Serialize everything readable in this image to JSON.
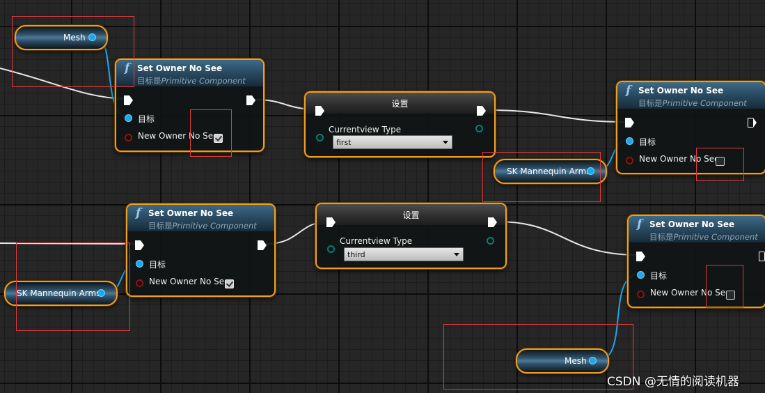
{
  "func_icon": "f",
  "function_nodes": [
    {
      "title": "Set Owner No See",
      "subtitle_prefix": "目标是",
      "subtitle_class": "Primitive Component",
      "target_label": "目标",
      "bool_label": "New Owner No See",
      "bool_value": true
    },
    {
      "title": "Set Owner No See",
      "subtitle_prefix": "目标是",
      "subtitle_class": "Primitive Component",
      "target_label": "目标",
      "bool_label": "New Owner No See",
      "bool_value": false
    },
    {
      "title": "Set Owner No See",
      "subtitle_prefix": "目标是",
      "subtitle_class": "Primitive Component",
      "target_label": "目标",
      "bool_label": "New Owner No See",
      "bool_value": true
    },
    {
      "title": "Set Owner No See",
      "subtitle_prefix": "目标是",
      "subtitle_class": "Primitive Component",
      "target_label": "目标",
      "bool_label": "New Owner No See",
      "bool_value": false
    }
  ],
  "set_nodes": [
    {
      "title": "设置",
      "pin_label": "Currentview Type",
      "selected": "first"
    },
    {
      "title": "设置",
      "pin_label": "Currentview Type",
      "selected": "third"
    }
  ],
  "variables": [
    {
      "label": "Mesh"
    },
    {
      "label": "SK Mannequin Arms"
    },
    {
      "label": "SK Mannequin Arms"
    },
    {
      "label": "Mesh"
    }
  ],
  "watermark": "CSDN @无情的阅读机器",
  "colors": {
    "node_border": "#f0a020",
    "object_pin": "#1ea8ea",
    "bool_pin": "#8a1616",
    "enum_pin": "#0a7e72",
    "highlight_box": "#e23b3b",
    "wire_exec": "#ffffff",
    "wire_object": "#1ea8ea"
  }
}
